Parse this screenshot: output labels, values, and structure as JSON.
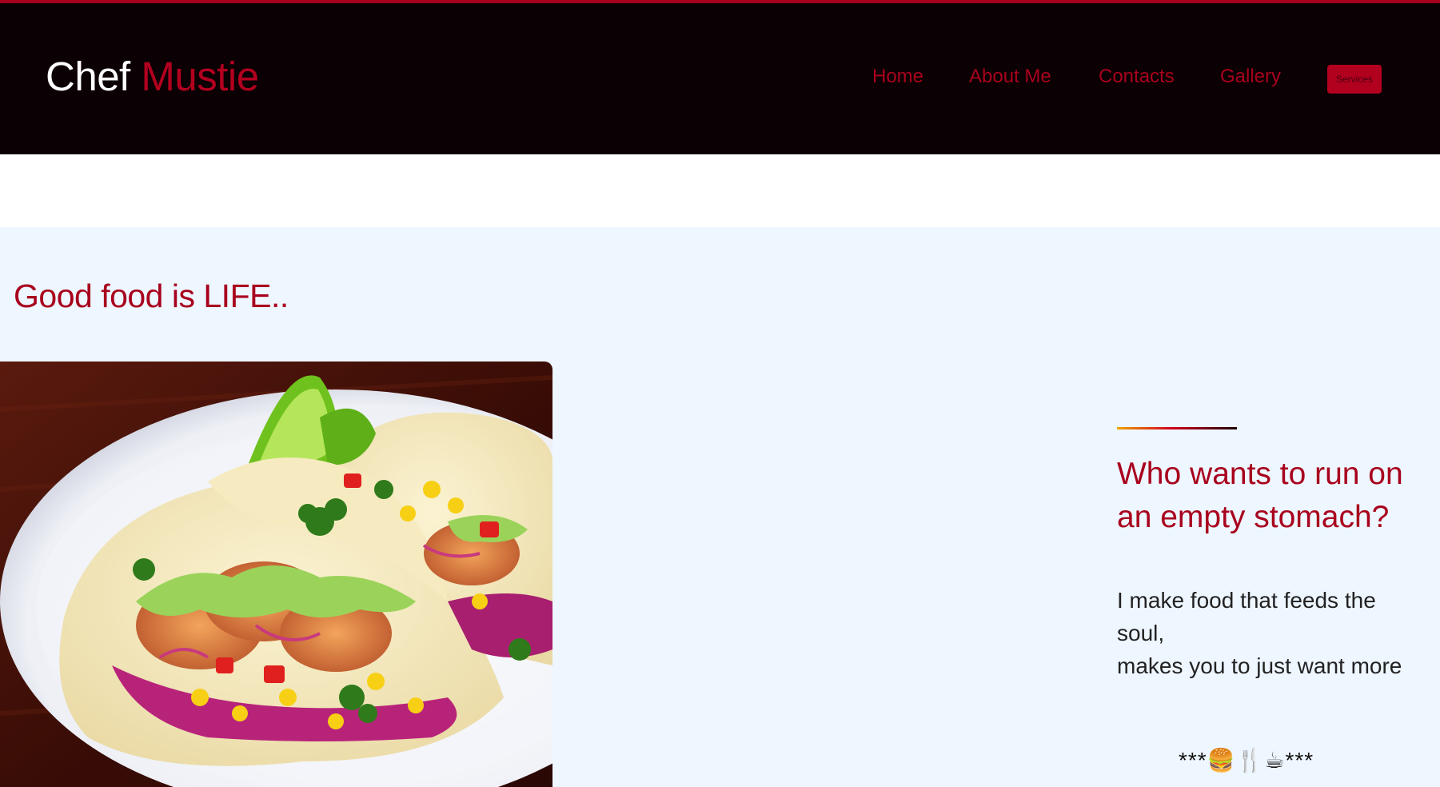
{
  "header": {
    "brand_first": "Chef",
    "brand_second": "Mustie",
    "nav": [
      {
        "label": "Home"
      },
      {
        "label": "About Me"
      },
      {
        "label": "Contacts"
      },
      {
        "label": "Gallery"
      }
    ],
    "services_label": "Services"
  },
  "hero": {
    "tagline": "Good food is LIFE..",
    "image_alt": "Plate of shrimp tacos with lime, corn and cilantro",
    "headline": "Who wants to run on an empty stomach?",
    "body_line1": "I make food that feeds the soul,",
    "body_line2": "makes you to just want more",
    "ornament": "***🍔🍴☕***"
  },
  "colors": {
    "accent": "#a8001d",
    "header_bg": "#0b0003",
    "hero_bg": "#eef6ff"
  }
}
